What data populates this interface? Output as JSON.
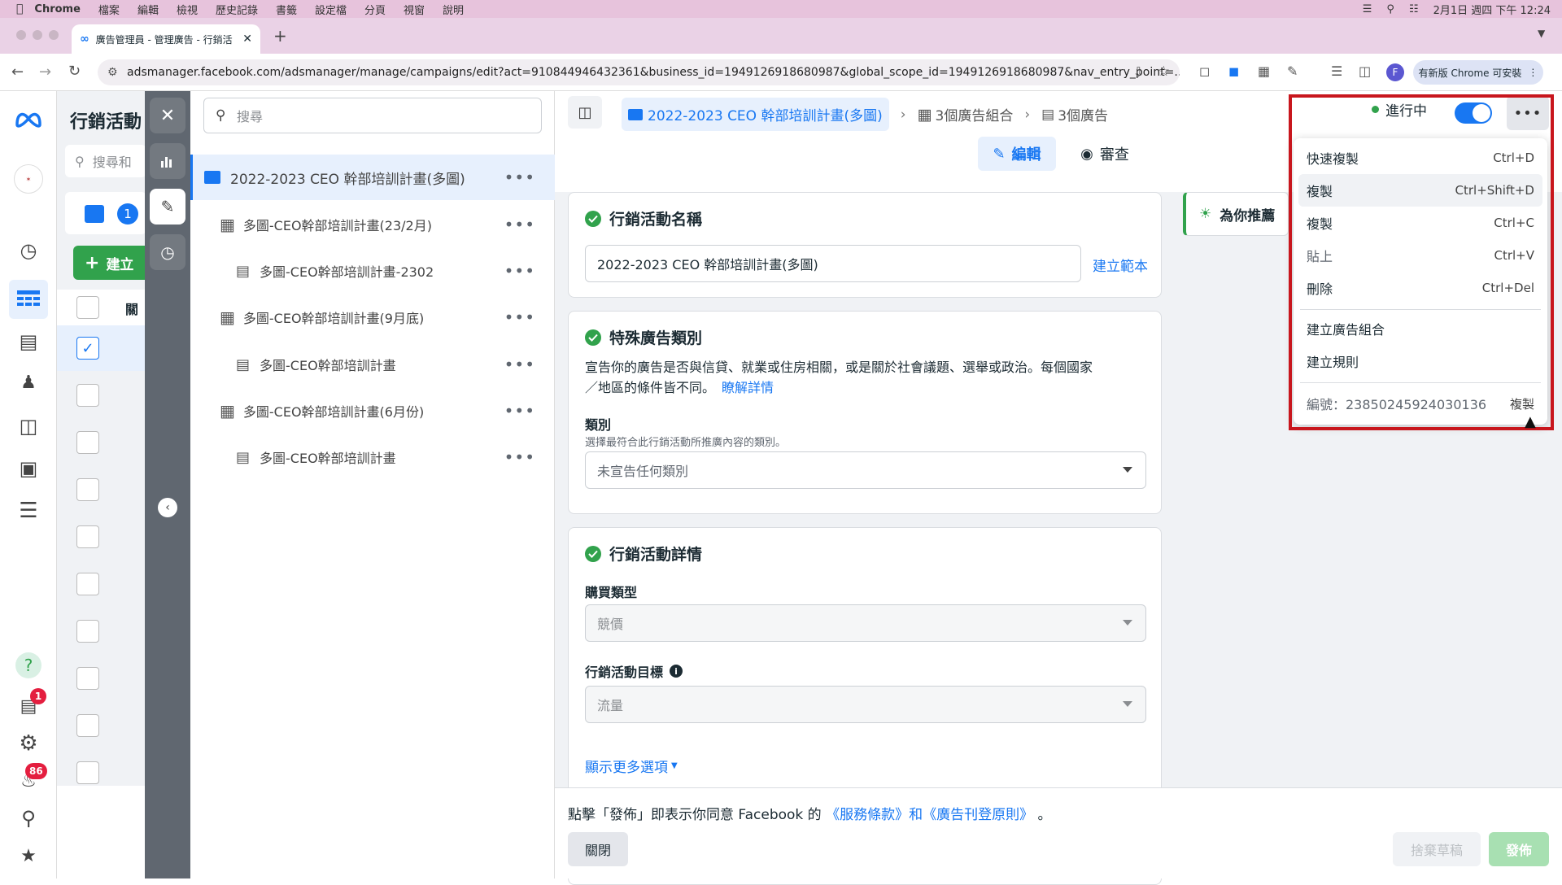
{
  "mac": {
    "app": "Chrome",
    "menus": [
      "檔案",
      "編輯",
      "檢視",
      "歷史記錄",
      "書籤",
      "設定檔",
      "分頁",
      "視窗",
      "說明"
    ],
    "datetime": "2月1日 週四 下午 12:24"
  },
  "browser": {
    "tab_title": "廣告管理員 - 管理廣告 - 行銷活",
    "url": "adsmanager.facebook.com/adsmanager/manage/campaigns/edit?act=910844946432361&business_id=1949126918680987&global_scope_id=1949126918680987&nav_entry_point=...",
    "update_label": "有新版 Chrome 可安裝",
    "profile_initial": "F"
  },
  "rail": {
    "help_badge": "1",
    "notif_badge": "86"
  },
  "under": {
    "title": "行銷活動",
    "search_placeholder": "搜尋和",
    "count": "1",
    "create_label": "建立",
    "col_header": "關"
  },
  "tree": {
    "search_placeholder": "搜尋",
    "items": [
      {
        "label": "2022-2023 CEO 幹部培訓計畫(多圖)",
        "type": "campaign"
      },
      {
        "label": "多圖-CEO幹部培訓計畫(23/2月)",
        "type": "adset"
      },
      {
        "label": "多圖-CEO幹部培訓計畫-2302",
        "type": "ad"
      },
      {
        "label": "多圖-CEO幹部培訓計畫(9月底)",
        "type": "adset"
      },
      {
        "label": "多圖-CEO幹部培訓計畫",
        "type": "ad"
      },
      {
        "label": "多圖-CEO幹部培訓計畫(6月份)",
        "type": "adset"
      },
      {
        "label": "多圖-CEO幹部培訓計畫",
        "type": "ad"
      }
    ]
  },
  "breadcrumb": {
    "campaign": "2022-2023 CEO 幹部培訓計畫(多圖)",
    "adsets": "3個廣告組合",
    "ads": "3個廣告"
  },
  "modes": {
    "edit": "編輯",
    "review": "審查"
  },
  "status": {
    "label": "進行中",
    "on": true
  },
  "campaign_name": {
    "title": "行銷活動名稱",
    "value": "2022-2023 CEO 幹部培訓計畫(多圖)",
    "template_link": "建立範本"
  },
  "special": {
    "title": "特殊廣告類別",
    "desc1": "宣告你的廣告是否與信貸、就業或住房相關，或是關於社會議題、選舉或政治。每個國家",
    "desc2": "／地區的條件皆不同。",
    "learn_more": "瞭解詳情",
    "category_label": "類別",
    "category_sub": "選擇最符合此行銷活動所推廣內容的類別。",
    "category_value": "未宣告任何類別"
  },
  "details": {
    "title": "行銷活動詳情",
    "buy_label": "購買類型",
    "buy_value": "競價",
    "objective_label": "行銷活動目標",
    "objective_value": "流量",
    "more_options": "顯示更多選項"
  },
  "recommend": {
    "label": "為你推薦"
  },
  "footer": {
    "terms_prefix": "點擊「發佈」即表示你同意 Facebook 的",
    "terms_links": "《服務條款》和《廣告刊登原則》",
    "terms_suffix": "。",
    "close": "關閉",
    "discard": "捨棄草稿",
    "publish": "發佈"
  },
  "menu": {
    "items": [
      {
        "label": "快速複製",
        "shortcut": "Ctrl+D"
      },
      {
        "label": "複製",
        "shortcut": "Ctrl+Shift+D"
      },
      {
        "label": "複製",
        "shortcut": "Ctrl+C"
      },
      {
        "label": "貼上",
        "shortcut": "Ctrl+V"
      },
      {
        "label": "刪除",
        "shortcut": "Ctrl+Del"
      },
      {
        "label": "建立廣告組合",
        "shortcut": ""
      },
      {
        "label": "建立規則",
        "shortcut": ""
      }
    ],
    "id_text": "編號：23850245924030136",
    "id_copy": "複製"
  },
  "colors": {
    "accent": "#1877f2",
    "success": "#31a24c",
    "highlight": "#c8161d",
    "publish": "#a8e0b2"
  }
}
